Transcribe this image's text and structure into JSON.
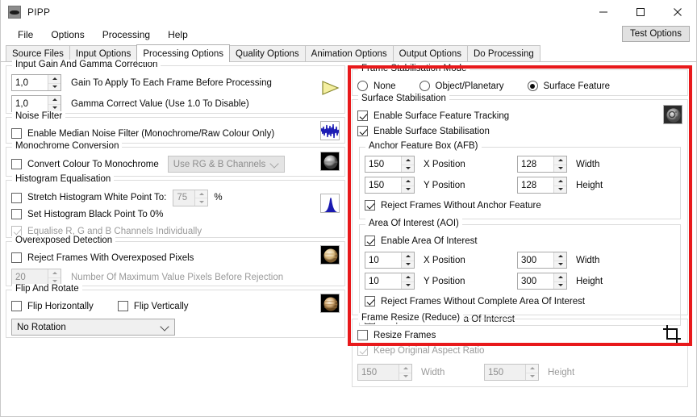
{
  "window": {
    "title": "PIPP",
    "icon": "app-icon",
    "minimize": "–",
    "maximize": "□",
    "close": "✕"
  },
  "menu": {
    "items": [
      "File",
      "Options",
      "Processing",
      "Help"
    ],
    "test_options_label": "Test Options"
  },
  "tabs": [
    {
      "label": "Source Files",
      "active": false
    },
    {
      "label": "Input Options",
      "active": false
    },
    {
      "label": "Processing Options",
      "active": true
    },
    {
      "label": "Quality Options",
      "active": false
    },
    {
      "label": "Animation Options",
      "active": false
    },
    {
      "label": "Output Options",
      "active": false
    },
    {
      "label": "Do Processing",
      "active": false
    }
  ],
  "left": {
    "input_gain": {
      "legend": "Input Gain And Gamma Correction",
      "gain_value": "1,0",
      "gain_label": "Gain To Apply To Each Frame Before Processing",
      "gamma_value": "1,0",
      "gamma_label": "Gamma Correct Value (Use 1.0 To Disable)",
      "thumb": "yellow-play-triangle-icon"
    },
    "noise_filter": {
      "legend": "Noise Filter",
      "enable_label": "Enable Median Noise Filter (Monochrome/Raw Colour Only)",
      "enable_checked": false,
      "thumb": "waveform-icon"
    },
    "monochrome": {
      "legend": "Monochrome Conversion",
      "convert_label": "Convert Colour To Monochrome",
      "convert_checked": false,
      "channel_select": "Use RG & B Channels",
      "channel_enabled": false,
      "thumb": "grey-planet-icon"
    },
    "histogram": {
      "legend": "Histogram Equalisation",
      "stretch_label": "Stretch Histogram White Point To:",
      "stretch_checked": false,
      "stretch_value": "75",
      "percent_sign": "%",
      "black_point_label": "Set Histogram Black Point To 0%",
      "black_point_checked": false,
      "equalise_label": "Equalise R, G and B Channels Individually",
      "equalise_checked": true,
      "equalise_enabled": false,
      "thumb": "histogram-icon"
    },
    "overexposed": {
      "legend": "Overexposed Detection",
      "reject_label": "Reject Frames With Overexposed Pixels",
      "reject_checked": false,
      "max_pixels_value": "20",
      "max_pixels_label": "Number Of Maximum Value Pixels Before Rejection",
      "max_pixels_enabled": false,
      "thumb": "overexposed-planet-icon"
    },
    "flip_rotate": {
      "legend": "Flip And Rotate",
      "flip_h_label": "Flip Horizontally",
      "flip_h_checked": false,
      "flip_v_label": "Flip Vertically",
      "flip_v_checked": false,
      "rotation_select": "No Rotation",
      "thumb": "rotated-planet-icon"
    }
  },
  "right": {
    "stabilisation_mode": {
      "legend": "Frame Stabilisation Mode",
      "options": [
        "None",
        "Object/Planetary",
        "Surface Feature"
      ],
      "selected": "Surface Feature"
    },
    "surface_stabilisation": {
      "legend": "Surface Stabilisation",
      "tracking_label": "Enable Surface Feature Tracking",
      "tracking_checked": true,
      "stabilisation_label": "Enable Surface Stabilisation",
      "stabilisation_checked": true,
      "thumb": "moon-crater-icon"
    },
    "afb": {
      "legend": "Anchor Feature Box (AFB)",
      "x_value": "150",
      "x_label": "X Position",
      "width_value": "128",
      "width_label": "Width",
      "y_value": "150",
      "y_label": "Y Position",
      "height_value": "128",
      "height_label": "Height",
      "reject_label": "Reject Frames Without Anchor Feature",
      "reject_checked": true
    },
    "aoi": {
      "legend": "Area Of Interest (AOI)",
      "enable_label": "Enable Area Of Interest",
      "enable_checked": true,
      "x_value": "10",
      "x_label": "X Position",
      "width_value": "300",
      "width_label": "Width",
      "y_value": "10",
      "y_label": "Y Position",
      "height_value": "300",
      "height_label": "Height",
      "reject_label": "Reject Frames Without Complete Area Of Interest",
      "reject_checked": true,
      "crop_label": "Crop Frames To Area Of Interest",
      "crop_checked": true
    },
    "frame_resize": {
      "legend": "Frame Resize (Reduce)",
      "resize_label": "Resize Frames",
      "resize_checked": false,
      "aspect_label": "Keep Original Aspect Ratio",
      "aspect_checked": true,
      "aspect_enabled": false,
      "width_value": "150",
      "width_label": "Width",
      "height_value": "150",
      "height_label": "Height",
      "fields_enabled": false,
      "thumb": "crop-icon"
    }
  },
  "colors": {
    "highlight_red": "#e8191b",
    "accent_yellow": "#f2ec7a",
    "window_bg": "#ffffff",
    "group_border": "#dcdcdc"
  }
}
